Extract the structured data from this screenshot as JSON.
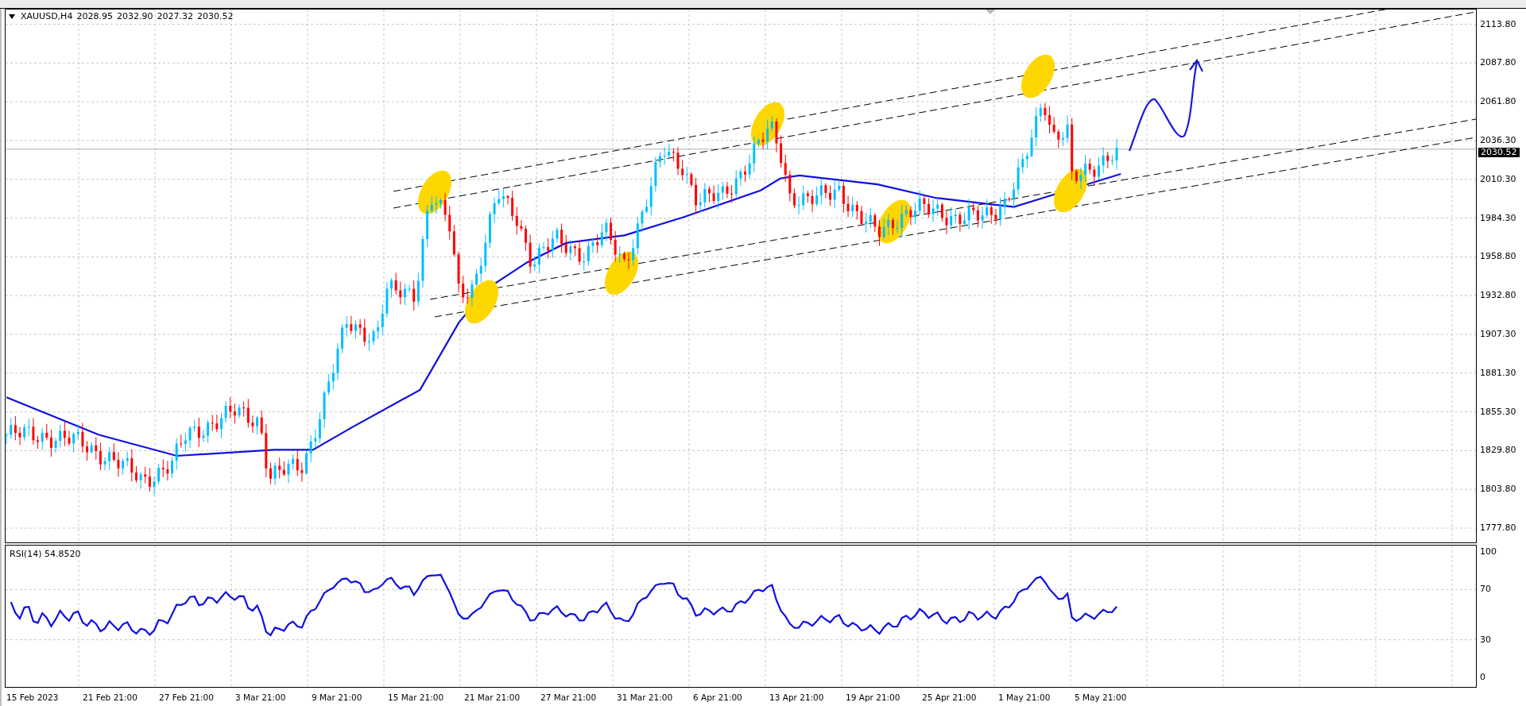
{
  "symbol_header": {
    "symbol": "XAUUSD,H4",
    "open": "2028.95",
    "high": "2032.90",
    "low": "2027.32",
    "close": "2030.52"
  },
  "price_axis": {
    "ticks": [
      "2113.80",
      "2087.80",
      "2061.80",
      "2036.30",
      "2010.30",
      "1984.30",
      "1958.80",
      "1932.80",
      "1907.30",
      "1881.30",
      "1855.30",
      "1829.80",
      "1803.80",
      "1777.80"
    ],
    "current_price": "2030.52"
  },
  "rsi_pane": {
    "label": "RSI(14) 54.8520",
    "ticks": [
      "100",
      "70",
      "30",
      "0"
    ]
  },
  "time_axis": {
    "labels": [
      "15 Feb 2023",
      "21 Feb 21:00",
      "27 Feb 21:00",
      "3 Mar 21:00",
      "9 Mar 21:00",
      "15 Mar 21:00",
      "21 Mar 21:00",
      "27 Mar 21:00",
      "31 Mar 21:00",
      "6 Apr 21:00",
      "13 Apr 21:00",
      "19 Apr 21:00",
      "25 Apr 21:00",
      "1 May 21:00",
      "5 May 21:00"
    ]
  }
}
